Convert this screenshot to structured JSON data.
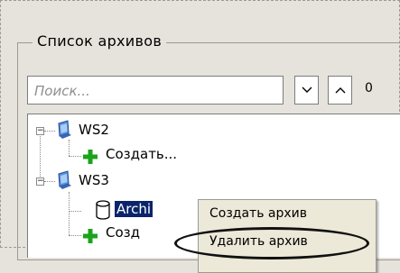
{
  "groupbox": {
    "title": "Список архивов"
  },
  "search": {
    "placeholder": "Поиск...",
    "value": ""
  },
  "nav": {
    "down_icon": "chevron-down-icon",
    "up_icon": "chevron-up-icon",
    "count": "0"
  },
  "tree": {
    "nodes": [
      {
        "label": "WS2",
        "icon": "computer-icon",
        "expanded": true
      },
      {
        "label": "Создать...",
        "icon": "add-icon"
      },
      {
        "label": "WS3",
        "icon": "computer-icon",
        "expanded": true
      },
      {
        "label": "Archi",
        "icon": "database-icon",
        "selected": true
      },
      {
        "label": "Созд",
        "icon": "add-icon"
      }
    ]
  },
  "context_menu": {
    "items": [
      {
        "label": "Создать архив"
      },
      {
        "label": "Удалить архив",
        "highlighted": true
      }
    ]
  },
  "colors": {
    "selection": "#0a246a",
    "add_icon": "#1aa31a"
  }
}
